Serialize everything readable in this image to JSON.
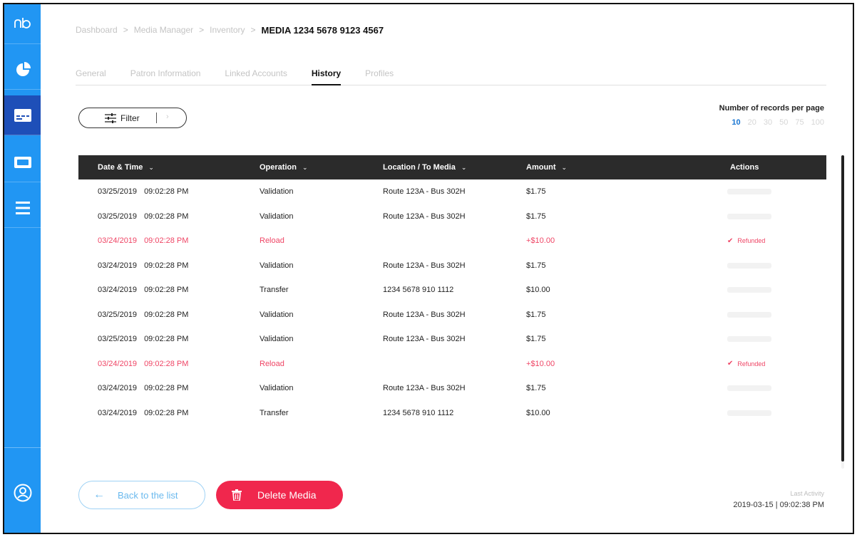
{
  "sidebar": {
    "logo": "nb",
    "items": [
      {
        "icon": "pie-chart-icon"
      },
      {
        "icon": "media-card-icon",
        "active": true
      },
      {
        "icon": "ticket-icon"
      },
      {
        "icon": "list-icon"
      }
    ],
    "profile_icon": "user-icon"
  },
  "breadcrumb": {
    "items": [
      "Dashboard",
      "Media Manager",
      "Inventory"
    ],
    "separator": ">",
    "current": "MEDIA 1234 5678 9123 4567"
  },
  "tabs": [
    {
      "label": "General",
      "active": false
    },
    {
      "label": "Patron Information",
      "active": false
    },
    {
      "label": "Linked Accounts",
      "active": false
    },
    {
      "label": "History",
      "active": true
    },
    {
      "label": "Profiles",
      "active": false
    }
  ],
  "filter": {
    "label": "Filter",
    "extra": "›"
  },
  "records_per_page": {
    "title": "Number of records per page",
    "options": [
      "10",
      "20",
      "30",
      "50",
      "75",
      "100"
    ],
    "selected": "10"
  },
  "table": {
    "headers": {
      "date": "Date & Time",
      "operation": "Operation",
      "location": "Location / To Media",
      "amount": "Amount",
      "actions": "Actions"
    },
    "rows": [
      {
        "date": "03/25/2019",
        "time": "09:02:28 PM",
        "operation": "Validation",
        "location": "Route 123A - Bus 302H",
        "amount": "$1.75",
        "status": ""
      },
      {
        "date": "03/25/2019",
        "time": "09:02:28 PM",
        "operation": "Validation",
        "location": "Route 123A - Bus 302H",
        "amount": "$1.75",
        "status": ""
      },
      {
        "date": "03/24/2019",
        "time": "09:02:28 PM",
        "operation": "Reload",
        "location": "",
        "amount": "+$10.00",
        "status": "Refunded",
        "highlight": true
      },
      {
        "date": "03/24/2019",
        "time": "09:02:28 PM",
        "operation": "Validation",
        "location": "Route 123A - Bus 302H",
        "amount": "$1.75",
        "status": ""
      },
      {
        "date": "03/24/2019",
        "time": "09:02:28 PM",
        "operation": "Transfer",
        "location": "1234 5678 910 1112",
        "amount": "$10.00",
        "status": ""
      },
      {
        "date": "03/25/2019",
        "time": "09:02:28 PM",
        "operation": "Validation",
        "location": "Route 123A - Bus 302H",
        "amount": "$1.75",
        "status": ""
      },
      {
        "date": "03/25/2019",
        "time": "09:02:28 PM",
        "operation": "Validation",
        "location": "Route 123A - Bus 302H",
        "amount": "$1.75",
        "status": ""
      },
      {
        "date": "03/24/2019",
        "time": "09:02:28 PM",
        "operation": "Reload",
        "location": "",
        "amount": "+$10.00",
        "status": "Refunded",
        "highlight": true
      },
      {
        "date": "03/24/2019",
        "time": "09:02:28 PM",
        "operation": "Validation",
        "location": "Route 123A - Bus 302H",
        "amount": "$1.75",
        "status": ""
      },
      {
        "date": "03/24/2019",
        "time": "09:02:28 PM",
        "operation": "Transfer",
        "location": "1234 5678 910 1112",
        "amount": "$10.00",
        "status": ""
      }
    ]
  },
  "footer": {
    "back_label": "Back to the list",
    "delete_label": "Delete Media",
    "last_activity_label": "Last Activity",
    "last_activity_value": "2019-03-15 | 09:02:38 PM"
  },
  "colors": {
    "sidebar": "#2196f3",
    "sidebar_active": "#1e4fb8",
    "table_header": "#2b2b2b",
    "danger": "#f0274d",
    "refund_text": "#ef4565",
    "link_blue": "#1976d2"
  }
}
